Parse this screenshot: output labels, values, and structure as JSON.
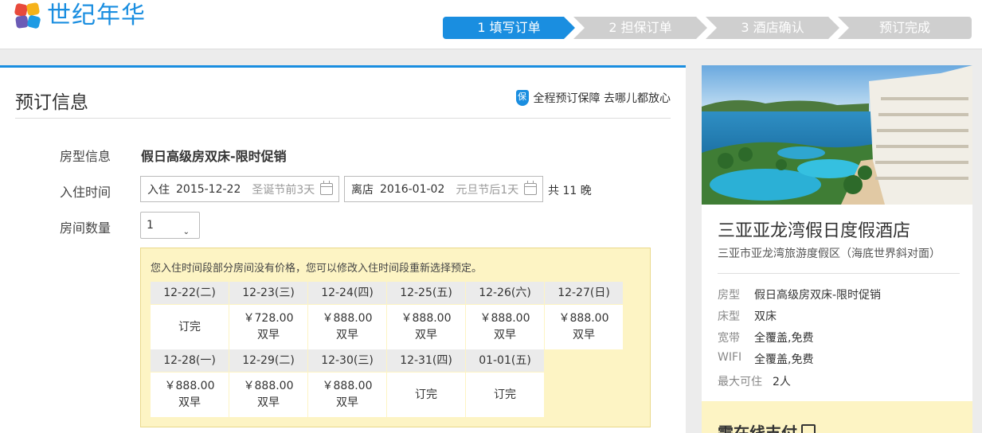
{
  "header": {
    "brand": "世纪年华",
    "steps": [
      {
        "label": "1 填写订单",
        "active": true
      },
      {
        "label": "2 担保订单",
        "active": false
      },
      {
        "label": "3 酒店确认",
        "active": false
      },
      {
        "label": "预订完成",
        "active": false
      }
    ]
  },
  "booking": {
    "title": "预订信息",
    "guarantee_icon": "保",
    "guarantee_text": "全程预订保障 去哪儿都放心",
    "room_type_label": "房型信息",
    "room_type_value": "假日高级房双床-限时促销",
    "checkin_label": "入住时间",
    "checkin": {
      "label": "入住",
      "date": "2015-12-22",
      "hint": "圣诞节前3天"
    },
    "checkout": {
      "label": "离店",
      "date": "2016-01-02",
      "hint": "元旦节后1天"
    },
    "nights_text": "共 11 晚",
    "rooms_label": "房间数量",
    "rooms_value": "1",
    "notice": "您入住时间段部分房间没有价格，您可以修改入住时间段重新选择预定。",
    "calendar": [
      {
        "date": "12-22(二)",
        "price": "订完",
        "meal": ""
      },
      {
        "date": "12-23(三)",
        "price": "￥728.00",
        "meal": "双早"
      },
      {
        "date": "12-24(四)",
        "price": "￥888.00",
        "meal": "双早"
      },
      {
        "date": "12-25(五)",
        "price": "￥888.00",
        "meal": "双早"
      },
      {
        "date": "12-26(六)",
        "price": "￥888.00",
        "meal": "双早"
      },
      {
        "date": "12-27(日)",
        "price": "￥888.00",
        "meal": "双早"
      },
      {
        "date": "12-28(一)",
        "price": "￥888.00",
        "meal": "双早"
      },
      {
        "date": "12-29(二)",
        "price": "￥888.00",
        "meal": "双早"
      },
      {
        "date": "12-30(三)",
        "price": "￥888.00",
        "meal": "双早"
      },
      {
        "date": "12-31(四)",
        "price": "订完",
        "meal": ""
      },
      {
        "date": "01-01(五)",
        "price": "订完",
        "meal": ""
      }
    ]
  },
  "hotel": {
    "name": "三亚亚龙湾假日度假酒店",
    "address": "三亚市亚龙湾旅游度假区（海底世界斜对面）",
    "details": [
      {
        "key": "房型",
        "value": "假日高级房双床-限时促销"
      },
      {
        "key": "床型",
        "value": "双床"
      },
      {
        "key": "宽带",
        "value": "全覆盖,免费"
      },
      {
        "key": "WIFI",
        "value": "全覆盖,免费"
      },
      {
        "key": "最大可住",
        "value": "2人"
      }
    ],
    "pay_title": "需在线支付"
  },
  "colors": {
    "accent": "#1a8ee0",
    "notice_bg": "#fdf4c4",
    "step_idle": "#cfcfcf"
  }
}
